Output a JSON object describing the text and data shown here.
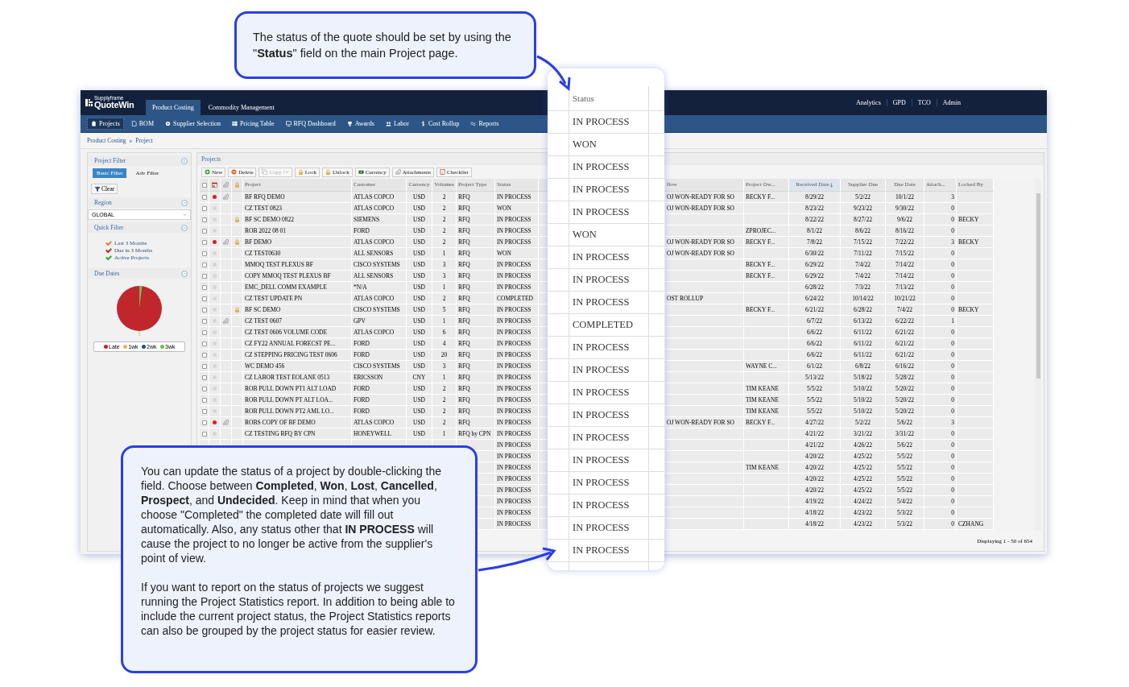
{
  "top_callout": {
    "text": "The status of the quote should be set by using the \"**Status**\" field on the main Project page."
  },
  "app": {
    "logo": {
      "brand": "Supplyframe",
      "name": "QuoteWin"
    },
    "tabs": [
      {
        "label": "Product Costing",
        "selected": true
      },
      {
        "label": "Commodity Management",
        "selected": false
      }
    ],
    "top_links": [
      "Analytics",
      "GPD",
      "TCO",
      "Admin"
    ],
    "subnav": [
      {
        "label": "Projects",
        "selected": true
      },
      {
        "label": "BOM",
        "selected": false
      },
      {
        "label": "Supplier Selection",
        "selected": false
      },
      {
        "label": "Pricing Table",
        "selected": false
      },
      {
        "label": "RFQ Dashboard",
        "selected": false
      },
      {
        "label": "Awards",
        "selected": false
      },
      {
        "label": "Labor",
        "selected": false
      },
      {
        "label": "Cost Rollup",
        "selected": false
      },
      {
        "label": "Reports",
        "selected": false
      }
    ],
    "breadcrumb": {
      "items": [
        "Product Costing",
        "Project"
      ],
      "separator": "»"
    },
    "filter_panel": {
      "title": "Project Filter",
      "modes": [
        {
          "label": "Basic Filter",
          "selected": true
        },
        {
          "label": "Adv Filter",
          "selected": false
        }
      ],
      "clear_button": "Clear",
      "region": {
        "title": "Region",
        "value": "GLOBAL"
      },
      "quick_filter": {
        "title": "Quick Filter",
        "items": [
          {
            "label": "Last 3 Months",
            "color": "#d9822b"
          },
          {
            "label": "Due in 3 Months",
            "color": "#c0272d"
          },
          {
            "label": "Active Projects",
            "color": "#3fa535"
          }
        ]
      },
      "due_dates": {
        "title": "Due Dates",
        "legend": [
          {
            "label": "Late",
            "color": "#c0272d"
          },
          {
            "label": "1wk",
            "color": "#e3b46b"
          },
          {
            "label": "2wk",
            "color": "#1f4e8c"
          },
          {
            "label": "3wk",
            "color": "#6abf4b"
          }
        ]
      }
    },
    "projects": {
      "title": "Projects",
      "toolbar": [
        {
          "label": "New",
          "disabled": false
        },
        {
          "label": "Delete",
          "disabled": false
        },
        {
          "label": "Copy",
          "disabled": true
        },
        {
          "label": "Lock",
          "disabled": false
        },
        {
          "label": "Unlock",
          "disabled": false
        },
        {
          "label": "Currency",
          "disabled": false
        },
        {
          "label": "Attachments",
          "disabled": false
        },
        {
          "label": "Checklist",
          "disabled": false
        }
      ],
      "select_all_checked": false,
      "columns": [
        {
          "label": "Project",
          "sorted": false
        },
        {
          "label": "Customer",
          "sorted": false
        },
        {
          "label": "Currency",
          "sorted": false
        },
        {
          "label": "Volumes",
          "sorted": false
        },
        {
          "label": "Project Type",
          "sorted": false
        },
        {
          "label": "Status",
          "sorted": false
        },
        {
          "label": "flow",
          "sorted": false
        },
        {
          "label": "Project Ow...",
          "sorted": false
        },
        {
          "label": "Received Date",
          "sorted": true
        },
        {
          "label": "Supplier Due",
          "sorted": false
        },
        {
          "label": "Due Date",
          "sorted": false
        },
        {
          "label": "Attach...",
          "sorted": false
        },
        {
          "label": "Locked By",
          "sorted": false
        }
      ],
      "rows": [
        {
          "checked": false,
          "flagged": true,
          "attachment": true,
          "locked": false,
          "project": "BF RFQ DEMO",
          "customer": "ATLAS COPCO",
          "currency": "USD",
          "volumes": "2",
          "project_type": "RFQ",
          "status": "IN PROCESS",
          "workflow": "OJ WON-READY FOR SO",
          "project_owner": "BECKY F...",
          "received_date": "8/29/22",
          "supplier_due": "5/2/22",
          "due_date": "10/1/22",
          "attachments": "3"
        },
        {
          "checked": false,
          "flagged": false,
          "attachment": false,
          "locked": false,
          "project": "CZ TEST 0823",
          "customer": "ATLAS COPCO",
          "currency": "USD",
          "volumes": "2",
          "project_type": "RFQ",
          "status": "WON",
          "workflow": "OJ WON-READY FOR SO",
          "received_date": "8/23/22",
          "supplier_due": "9/23/22",
          "due_date": "9/30/22",
          "attachments": "0"
        },
        {
          "checked": false,
          "flagged": false,
          "attachment": false,
          "locked": true,
          "project": "BF SC DEMO 0822",
          "customer": "SIEMENS",
          "currency": "USD",
          "volumes": "2",
          "project_type": "RFQ",
          "status": "IN PROCESS",
          "received_date": "8/22/22",
          "supplier_due": "8/27/22",
          "due_date": "9/6/22",
          "attachments": "0",
          "locked_by": "BECKY"
        },
        {
          "checked": false,
          "flagged": false,
          "attachment": false,
          "locked": false,
          "project": "ROB 2022 08 01",
          "customer": "FORD",
          "currency": "USD",
          "volumes": "2",
          "project_type": "RFQ",
          "status": "IN PROCESS",
          "project_owner": "ZPROJEC...",
          "received_date": "8/1/22",
          "supplier_due": "8/6/22",
          "due_date": "8/16/22",
          "attachments": "0"
        },
        {
          "checked": false,
          "flagged": true,
          "attachment": true,
          "locked": true,
          "project": "BF DEMO",
          "customer": "ATLAS COPCO",
          "currency": "USD",
          "volumes": "2",
          "project_type": "RFQ",
          "status": "IN PROCESS",
          "workflow": "OJ WON-READY FOR SO",
          "project_owner": "BECKY F...",
          "received_date": "7/8/22",
          "supplier_due": "7/15/22",
          "due_date": "7/22/22",
          "attachments": "3",
          "locked_by": "BECKY"
        },
        {
          "checked": false,
          "flagged": false,
          "attachment": false,
          "locked": false,
          "project": "CZ TEST0630",
          "customer": "ALL SENSORS",
          "currency": "USD",
          "volumes": "1",
          "project_type": "RFQ",
          "status": "WON",
          "workflow": "OJ WON-READY FOR SO",
          "received_date": "6/30/22",
          "supplier_due": "7/11/22",
          "due_date": "7/15/22",
          "attachments": "0"
        },
        {
          "checked": false,
          "flagged": false,
          "attachment": false,
          "locked": false,
          "project": "MMOQ TEST PLEXUS BF",
          "customer": "CISCO SYSTEMS",
          "currency": "USD",
          "volumes": "3",
          "project_type": "RFQ",
          "status": "IN PROCESS",
          "project_owner": "BECKY F...",
          "received_date": "6/29/22",
          "supplier_due": "7/4/22",
          "due_date": "7/14/22",
          "attachments": "0"
        },
        {
          "checked": false,
          "flagged": false,
          "attachment": false,
          "locked": false,
          "project": "COPY MMOQ TEST PLEXUS BF",
          "customer": "ALL SENSORS",
          "currency": "USD",
          "volumes": "3",
          "project_type": "RFQ",
          "status": "IN PROCESS",
          "project_owner": "BECKY F...",
          "received_date": "6/29/22",
          "supplier_due": "7/4/22",
          "due_date": "7/14/22",
          "attachments": "0"
        },
        {
          "checked": false,
          "flagged": false,
          "attachment": false,
          "locked": false,
          "project": "EMC_DELL COMM EXAMPLE",
          "customer": "*N/A",
          "currency": "USD",
          "volumes": "1",
          "project_type": "RFQ",
          "status": "IN PROCESS",
          "received_date": "6/28/22",
          "supplier_due": "7/3/22",
          "due_date": "7/13/22",
          "attachments": "0"
        },
        {
          "checked": false,
          "flagged": false,
          "attachment": false,
          "locked": false,
          "project": "CZ TEST UPDATE PN",
          "customer": "ATLAS COPCO",
          "currency": "USD",
          "volumes": "2",
          "project_type": "RFQ",
          "status": "COMPLETED",
          "workflow": "OST ROLLUP",
          "received_date": "6/24/22",
          "supplier_due": "10/14/22",
          "due_date": "10/21/22",
          "attachments": "0"
        },
        {
          "checked": false,
          "flagged": false,
          "attachment": false,
          "locked": true,
          "project": "BF SC DEMO",
          "customer": "CISCO SYSTEMS",
          "currency": "USD",
          "volumes": "5",
          "project_type": "RFQ",
          "status": "IN PROCESS",
          "project_owner": "BECKY F...",
          "received_date": "6/21/22",
          "supplier_due": "6/28/22",
          "due_date": "7/4/22",
          "attachments": "0",
          "locked_by": "BECKY"
        },
        {
          "checked": false,
          "flagged": false,
          "attachment": true,
          "locked": false,
          "project": "CZ TEST 0607",
          "customer": "GPV",
          "currency": "USD",
          "volumes": "1",
          "project_type": "RFQ",
          "status": "IN PROCESS",
          "received_date": "6/7/22",
          "supplier_due": "6/13/22",
          "due_date": "6/22/22",
          "attachments": "1"
        },
        {
          "checked": false,
          "flagged": false,
          "attachment": false,
          "locked": false,
          "project": "CZ TEST 0606 VOLUME CODE",
          "customer": "ATLAS COPCO",
          "currency": "USD",
          "volumes": "6",
          "project_type": "RFQ",
          "status": "IN PROCESS",
          "received_date": "6/6/22",
          "supplier_due": "6/11/22",
          "due_date": "6/21/22",
          "attachments": "0"
        },
        {
          "checked": false,
          "flagged": false,
          "attachment": false,
          "locked": false,
          "project": "CZ FY22 ANNUAL FORECST PE...",
          "customer": "FORD",
          "currency": "USD",
          "volumes": "4",
          "project_type": "RFQ",
          "status": "IN PROCESS",
          "received_date": "6/6/22",
          "supplier_due": "6/11/22",
          "due_date": "6/21/22",
          "attachments": "0"
        },
        {
          "checked": false,
          "flagged": false,
          "attachment": false,
          "locked": false,
          "project": "CZ STEPPING PRICING TEST 0606",
          "customer": "FORD",
          "currency": "USD",
          "volumes": "20",
          "project_type": "RFQ",
          "status": "IN PROCESS",
          "received_date": "6/6/22",
          "supplier_due": "6/11/22",
          "due_date": "6/21/22",
          "attachments": "0"
        },
        {
          "checked": false,
          "flagged": false,
          "attachment": false,
          "locked": false,
          "project": "WC DEMO 456",
          "customer": "CISCO SYSTEMS",
          "currency": "USD",
          "volumes": "3",
          "project_type": "RFQ",
          "status": "IN PROCESS",
          "project_owner": "WAYNE C...",
          "received_date": "6/1/22",
          "supplier_due": "6/8/22",
          "due_date": "6/16/22",
          "attachments": "0"
        },
        {
          "checked": false,
          "flagged": false,
          "attachment": false,
          "locked": false,
          "project": "CZ LABOR TEST EOLANE 0513",
          "customer": "ERICSSON",
          "currency": "CNY",
          "volumes": "1",
          "project_type": "RFQ",
          "status": "IN PROCESS",
          "received_date": "5/13/22",
          "supplier_due": "5/18/22",
          "due_date": "5/28/22",
          "attachments": "0"
        },
        {
          "checked": false,
          "flagged": false,
          "attachment": false,
          "locked": false,
          "project": "ROB PULL DOWN PT1 ALT LOAD",
          "customer": "FORD",
          "currency": "USD",
          "volumes": "2",
          "project_type": "RFQ",
          "status": "IN PROCESS",
          "project_owner": "TIM KEANE",
          "received_date": "5/5/22",
          "supplier_due": "5/10/22",
          "due_date": "5/20/22",
          "attachments": "0"
        },
        {
          "checked": false,
          "flagged": false,
          "attachment": false,
          "locked": false,
          "project": "ROB PULL DOWN PT ALT LOA...",
          "customer": "FORD",
          "currency": "USD",
          "volumes": "2",
          "project_type": "RFQ",
          "status": "IN PROCESS",
          "project_owner": "TIM KEANE",
          "received_date": "5/5/22",
          "supplier_due": "5/10/22",
          "due_date": "5/20/22",
          "attachments": "0"
        },
        {
          "checked": false,
          "flagged": false,
          "attachment": false,
          "locked": false,
          "project": "ROB PULL DOWN PT2 AML LO...",
          "customer": "FORD",
          "currency": "USD",
          "volumes": "2",
          "project_type": "RFQ",
          "status": "IN PROCESS",
          "project_owner": "TIM KEANE",
          "received_date": "5/5/22",
          "supplier_due": "5/10/22",
          "due_date": "5/20/22",
          "attachments": "0"
        },
        {
          "checked": false,
          "flagged": true,
          "attachment": true,
          "locked": false,
          "project": "ROBS COPY OF BF DEMO",
          "customer": "ATLAS COPCO",
          "currency": "USD",
          "volumes": "2",
          "project_type": "RFQ",
          "status": "IN PROCESS",
          "workflow": "OJ WON-READY FOR SO",
          "project_owner": "BECKY F...",
          "received_date": "4/27/22",
          "supplier_due": "5/2/22",
          "due_date": "5/6/22",
          "attachments": "3"
        },
        {
          "checked": false,
          "flagged": false,
          "attachment": false,
          "locked": false,
          "project": "CZ TESTING RFQ BY CPN",
          "customer": "HONEYWELL",
          "currency": "USD",
          "volumes": "1",
          "project_type": "RFQ by CPN",
          "status": "IN PROCESS",
          "received_date": "4/21/22",
          "supplier_due": "3/21/22",
          "due_date": "3/31/22",
          "attachments": "0"
        },
        {
          "status": "IN PROCESS",
          "received_date": "4/21/22",
          "supplier_due": "4/26/22",
          "due_date": "5/6/22",
          "attachments": "0"
        },
        {
          "status": "IN PROCESS",
          "received_date": "4/20/22",
          "supplier_due": "4/25/22",
          "due_date": "5/5/22",
          "attachments": "0"
        },
        {
          "status": "IN PROCESS",
          "project_owner": "TIM KEANE",
          "received_date": "4/20/22",
          "supplier_due": "4/25/22",
          "due_date": "5/5/22",
          "attachments": "0"
        },
        {
          "status": "IN PROCESS",
          "received_date": "4/20/22",
          "supplier_due": "4/25/22",
          "due_date": "5/5/22",
          "attachments": "0"
        },
        {
          "status": "IN PROCESS",
          "received_date": "4/20/22",
          "supplier_due": "4/25/22",
          "due_date": "5/5/22",
          "attachments": "0"
        },
        {
          "status": "IN PROCESS",
          "received_date": "4/19/22",
          "supplier_due": "4/24/22",
          "due_date": "5/4/22",
          "attachments": "0"
        },
        {
          "status": "IN PROCESS",
          "received_date": "4/18/22",
          "supplier_due": "4/23/22",
          "due_date": "5/3/22",
          "attachments": "0"
        },
        {
          "status": "IN PROCESS",
          "received_date": "4/18/22",
          "supplier_due": "4/23/22",
          "due_date": "5/3/22",
          "attachments": "0",
          "locked_by": "CZHANG"
        }
      ],
      "footer": "Displaying 1 - 50 of 654"
    }
  },
  "status_zoom": {
    "header": "Status",
    "values": [
      "IN PROCESS",
      "WON",
      "IN PROCESS",
      "IN PROCESS",
      "IN PROCESS",
      "WON",
      "IN PROCESS",
      "IN PROCESS",
      "IN PROCESS",
      "COMPLETED",
      "IN PROCESS",
      "IN PROCESS",
      "IN PROCESS",
      "IN PROCESS",
      "IN PROCESS",
      "IN PROCESS",
      "IN PROCESS",
      "IN PROCESS",
      "IN PROCESS",
      "IN PROCESS"
    ]
  },
  "bottom_callout": {
    "paragraphs": [
      "You can update the status of a project by double-clicking the field. Choose between **Completed**, **Won**, **Lost**, **Cancelled**, **Prospect**, and **Undecided**. Keep in mind that when you choose \"Completed\" the completed date will fill out automatically. Also, any status other that **IN PROCESS** will cause the project to no longer be active from the supplier's point of view.",
      "If you want to report on the status of projects we suggest running the Project Statistics report. In addition to being able to include the current project status, the Project Statistics reports can also be grouped by the project status for easier review."
    ]
  }
}
